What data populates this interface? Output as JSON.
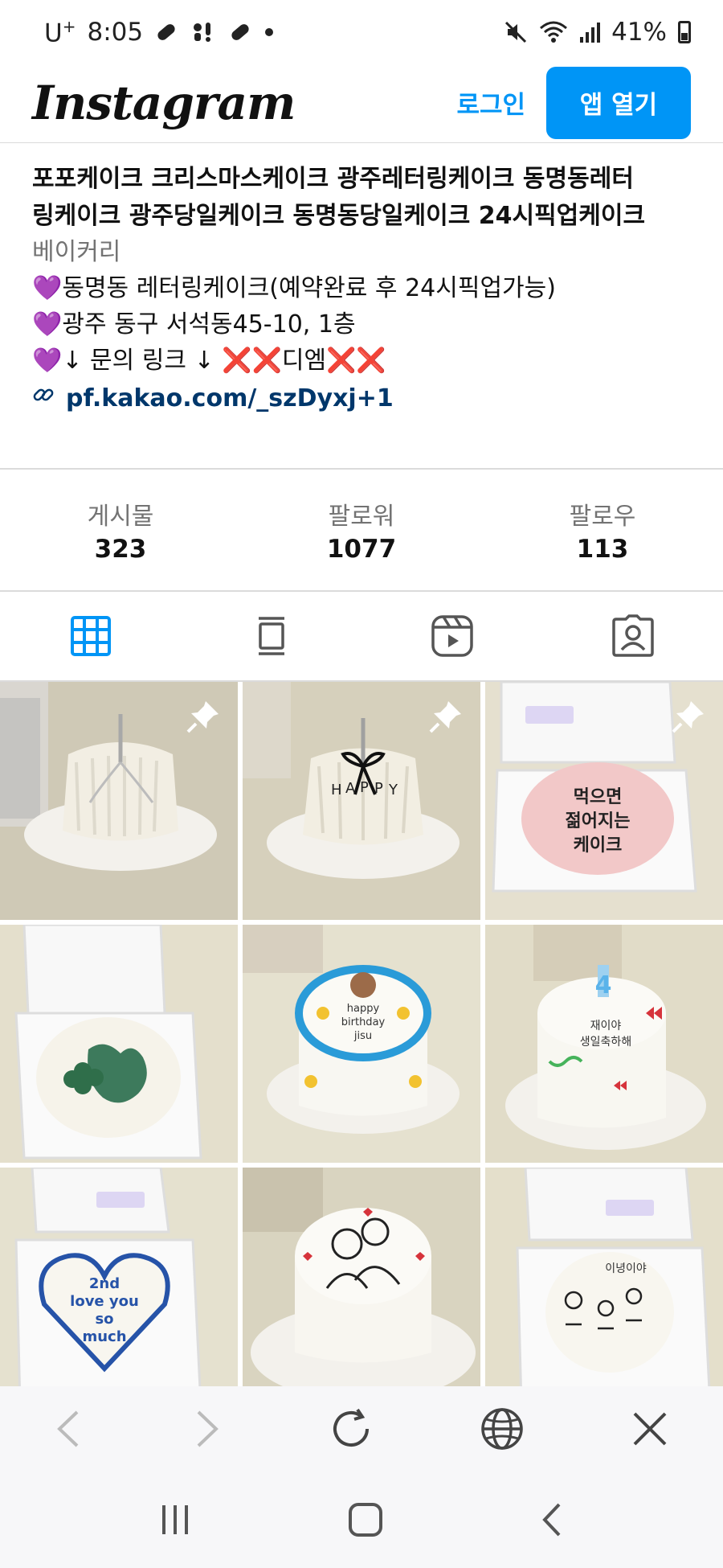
{
  "status_bar": {
    "carrier": "U",
    "carrier_sup": "+",
    "time": "8:05",
    "battery": "41%"
  },
  "header": {
    "logo": "Instagram",
    "login": "로그인",
    "open_app": "앱 열기"
  },
  "bio": {
    "title_line1": "포포케이크 크리스마스케이크 광주레터링케이크 동명동레터",
    "title_line2": "링케이크 광주당일케이크 동명동당일케이크 24시픽업케이크",
    "category": "베이커리",
    "line1": "💜동명동 레터링케이크(예약완료 후 24시픽업가능)",
    "line2": "💜광주 동구 서석동45-10, 1층",
    "line3": "💜↓ 문의 링크 ↓ ❌❌디엠❌❌",
    "link": "pf.kakao.com/_szDyxj+1"
  },
  "stats": [
    {
      "label": "게시물",
      "value": "323"
    },
    {
      "label": "팔로워",
      "value": "1077"
    },
    {
      "label": "팔로우",
      "value": "113"
    }
  ],
  "tabs": [
    "grid-icon",
    "feed-icon",
    "reels-icon",
    "tagged-icon"
  ],
  "posts": {
    "p3_text": "먹으면 젊어지는 케이크",
    "p5_text": "happy birthday jisu",
    "p6_text": "재이야 생일축하해",
    "p7_text": "2nd love you so much",
    "p9_text": "이녕이야"
  },
  "colors": {
    "accent": "#0095f6",
    "link": "#00376b",
    "muted": "#737373"
  }
}
